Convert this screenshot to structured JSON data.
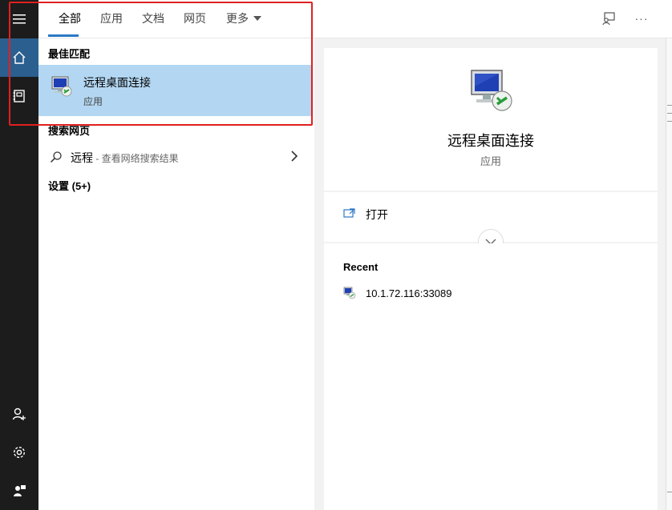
{
  "sidebar": {
    "items": [
      {
        "icon": "hamburger-menu-icon"
      },
      {
        "icon": "home-icon",
        "active": true
      },
      {
        "icon": "notebook-icon"
      },
      {
        "icon": "add-user-icon"
      },
      {
        "icon": "gear-icon"
      },
      {
        "icon": "feedback-person-icon"
      }
    ]
  },
  "tabs": [
    {
      "label": "全部",
      "active": true
    },
    {
      "label": "应用"
    },
    {
      "label": "文档"
    },
    {
      "label": "网页"
    },
    {
      "label": "更多"
    }
  ],
  "toolbar": {
    "feedback_icon": "feedback-icon",
    "more_options_icon": "more-options-icon",
    "more_options_glyph": "···"
  },
  "results": {
    "best_match_header": "最佳匹配",
    "best_match": {
      "title": "远程桌面连接",
      "subtitle": "应用",
      "icon": "remote-desktop-icon"
    },
    "web_header": "搜索网页",
    "web_item": {
      "query": "远程",
      "hint": " - 查看网络搜索结果"
    },
    "settings_header": "设置 (5+)"
  },
  "preview": {
    "title": "远程桌面连接",
    "subtitle": "应用",
    "open_label": "打开",
    "recent_header": "Recent",
    "recent_items": [
      "10.1.72.116:33089"
    ]
  },
  "colors": {
    "rail_bg": "#1c1c1c",
    "rail_active": "#2b5f8f",
    "selection": "#b3d7f2",
    "accent": "#2b79c4",
    "highlight_box": "#e02020"
  }
}
